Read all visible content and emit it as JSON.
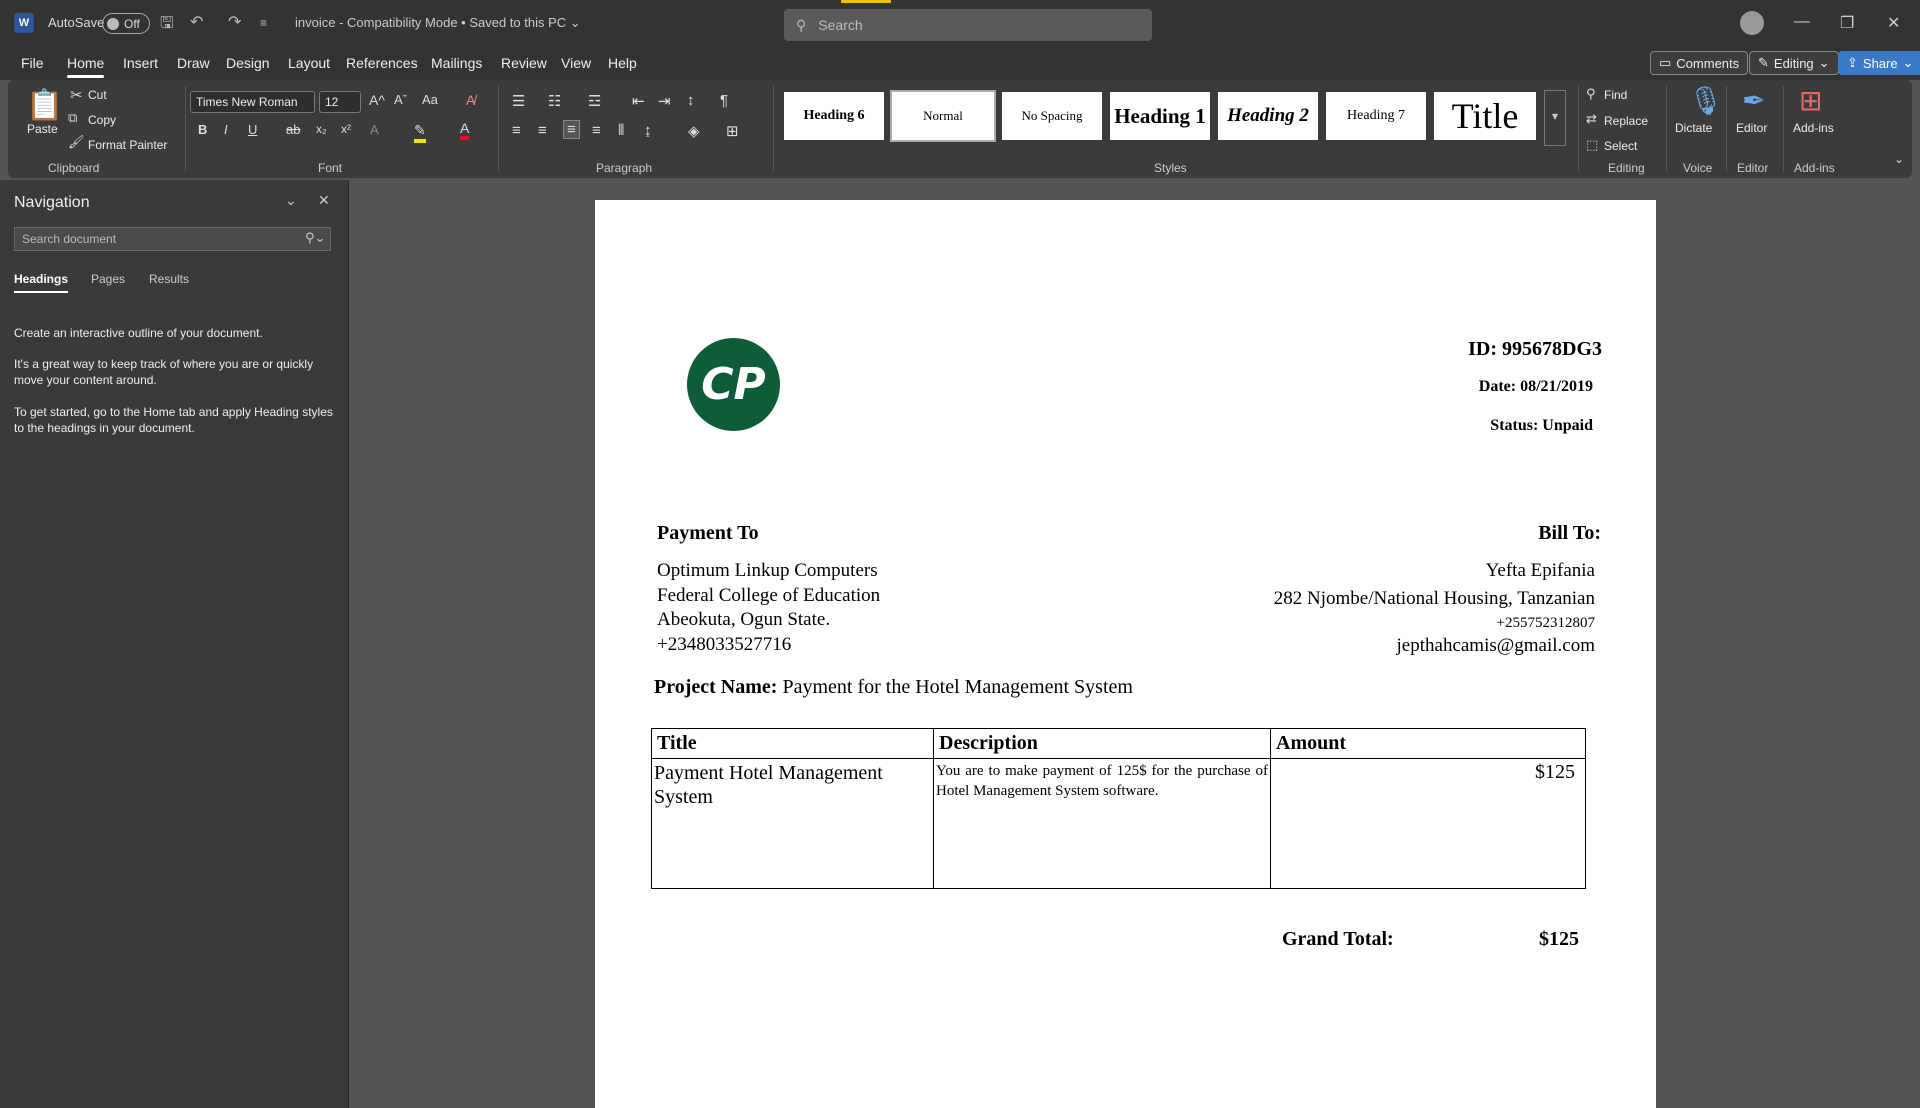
{
  "titlebar": {
    "app_icon": "W",
    "autosave_label": "AutoSave",
    "autosave_state": "Off",
    "doc_title": "invoice  -  Compatibility Mode  •  Saved to this PC ⌄",
    "search_placeholder": "Search",
    "qat_icons": [
      "save-icon",
      "undo-icon",
      "redo-icon",
      "customize-icon"
    ]
  },
  "menu": {
    "tabs": [
      "File",
      "Home",
      "Insert",
      "Draw",
      "Design",
      "Layout",
      "References",
      "Mailings",
      "Review",
      "View",
      "Help"
    ],
    "active": "Home",
    "comments": "Comments",
    "editing": "Editing",
    "share": "Share"
  },
  "ribbon": {
    "clipboard": {
      "paste": "Paste",
      "cut": "Cut",
      "copy": "Copy",
      "format_painter": "Format Painter",
      "label": "Clipboard"
    },
    "font": {
      "name": "Times New Roman",
      "size": "12",
      "label": "Font"
    },
    "paragraph": {
      "label": "Paragraph"
    },
    "styles": {
      "items": [
        "Heading 6",
        "Normal",
        "No Spacing",
        "Heading 1",
        "Heading 2",
        "Heading 7",
        "Title"
      ],
      "label": "Styles"
    },
    "editing": {
      "find": "Find",
      "replace": "Replace",
      "select": "Select",
      "label": "Editing"
    },
    "voice": {
      "dictate": "Dictate",
      "label": "Voice"
    },
    "editor": {
      "editor": "Editor",
      "label": "Editor"
    },
    "addins": {
      "addins": "Add-ins",
      "label": "Add-ins"
    }
  },
  "navigation": {
    "title": "Navigation",
    "search_placeholder": "Search document",
    "tabs": [
      "Headings",
      "Pages",
      "Results"
    ],
    "active_tab": "Headings",
    "p1": "Create an interactive outline of your document.",
    "p2": "It's a great way to keep track of where you are or quickly move your content around.",
    "p3": "To get started, go to the Home tab and apply Heading styles to the headings in your document."
  },
  "document": {
    "logo_text": "CP",
    "id": "ID: 995678DG3",
    "date": "Date: 08/21/2019",
    "status": "Status: Unpaid",
    "payment_to_heading": "Payment To",
    "payment_to": [
      "Optimum Linkup Computers",
      "Federal College of Education",
      "Abeokuta, Ogun State.",
      "+2348033527716"
    ],
    "bill_to_heading": "Bill To:",
    "bill_to": {
      "name": "Yefta Epifania",
      "address": "282 Njombe/National Housing, Tanzanian",
      "phone": "+255752312807",
      "email": "jepthahcamis@gmail.com"
    },
    "project_label": "Project Name:",
    "project_name": "Payment for the Hotel Management System",
    "table": {
      "headers": [
        "Title",
        "Description",
        "Amount"
      ],
      "row": {
        "title": "Payment Hotel Management System",
        "description": "You are to make payment of 125$ for the purchase of Hotel Management System software.",
        "amount": "$125"
      }
    },
    "grand_total_label": "Grand Total:",
    "grand_total": "$125"
  }
}
